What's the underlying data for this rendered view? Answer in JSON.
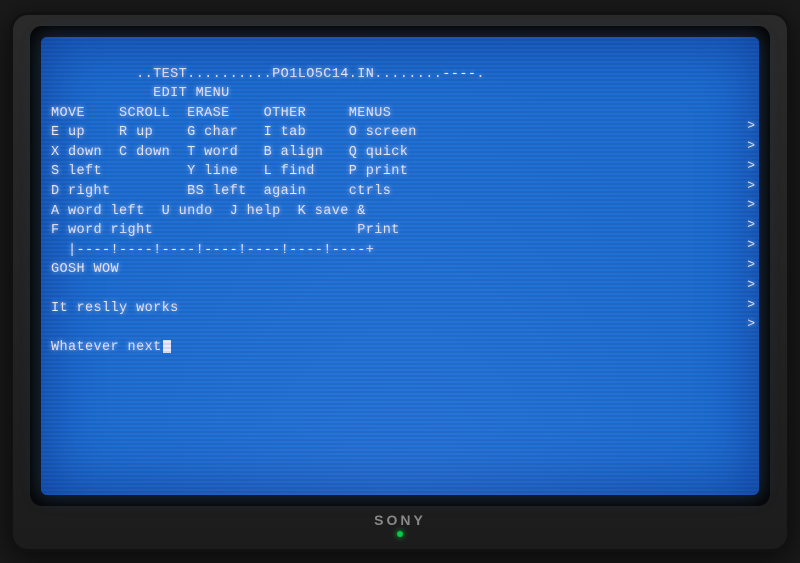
{
  "tv": {
    "brand": "SONY",
    "screen": {
      "line1": "..TEST..........PO1LO5C14.IN........----.",
      "line2": "            EDIT MENU",
      "line3": "MOVE    SCROLL  ERASE    OTHER     MENUS",
      "line4": "E up    R up    G char   I tab     O screen",
      "line5": "X down  C down  T word   B align   Q quick",
      "line6": "S left          Y line   L find    P print",
      "line7": "D right         BS left  again     ctrls",
      "line8": "A word left  U undo  J help  K save &",
      "line9": "F word right                        Print",
      "line10": "  |----!----!----!----!----!----!----+",
      "line11": "GOSH WOW",
      "line12": "",
      "line13": "It reslly works",
      "line14": "",
      "line15": "Whatever next"
    },
    "chevrons": [
      ">",
      ">",
      ">",
      ">",
      ">",
      ">",
      ">",
      ">",
      ">",
      ">",
      ">"
    ],
    "led_color": "#00cc44"
  }
}
